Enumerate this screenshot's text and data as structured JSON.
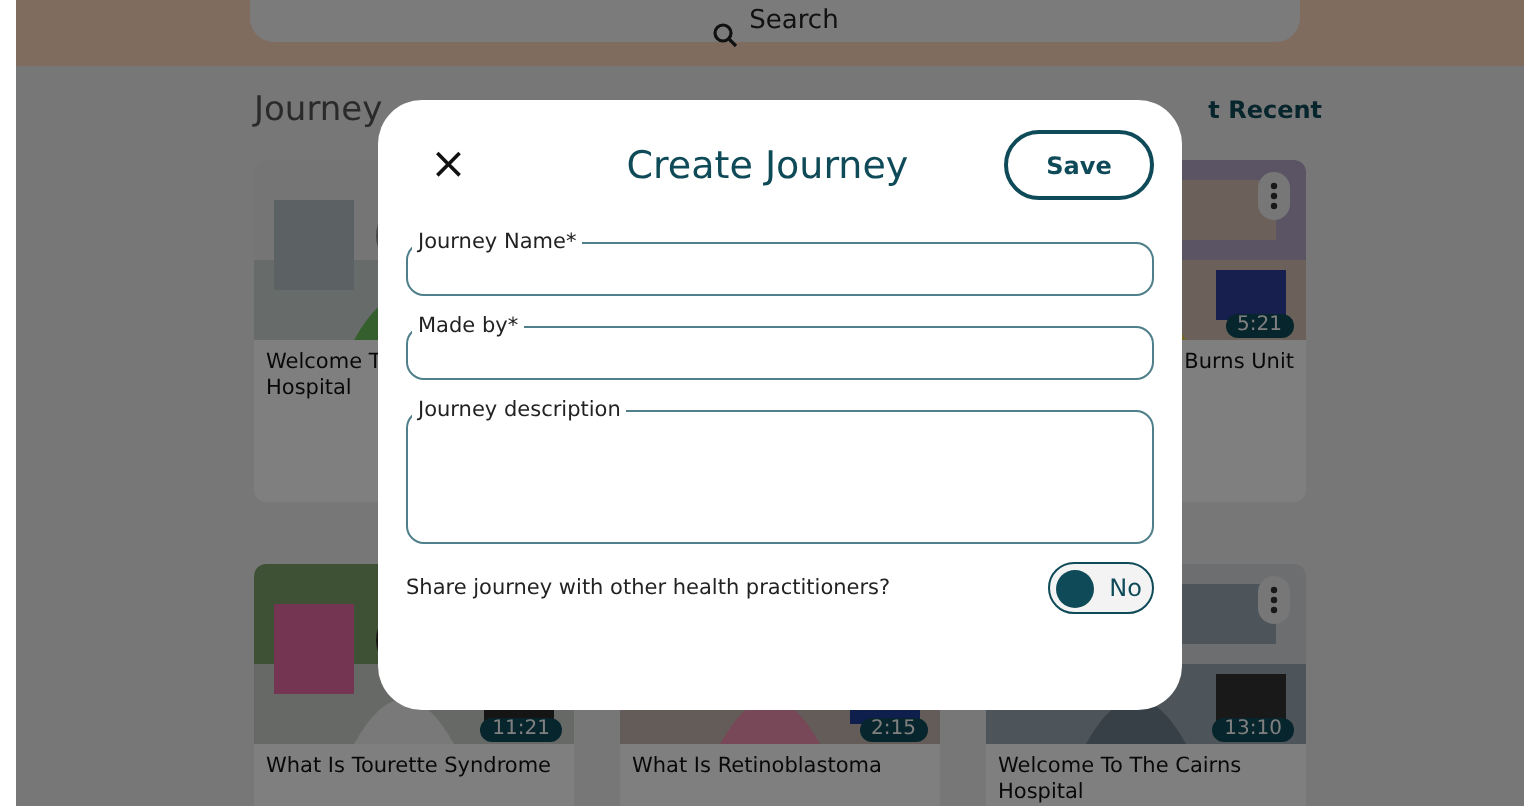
{
  "search": {
    "placeholder": "Search"
  },
  "section": {
    "title": "Journey",
    "sort": "t Recent"
  },
  "rows": [
    {
      "cards": [
        {
          "title_lines": [
            "Welcome T",
            "Hospital"
          ],
          "more": false
        },
        {
          "title_lines": [
            "Burns Unit"
          ],
          "duration": "5:21",
          "more": true
        }
      ]
    },
    {
      "cards": [
        {
          "title_lines": [
            "What Is Tourette Syndrome"
          ],
          "duration": "11:21",
          "more": false
        },
        {
          "title_lines": [
            "What Is Retinoblastoma"
          ],
          "duration": "2:15",
          "more": false
        },
        {
          "title_lines": [
            "Welcome To The Cairns",
            "Hospital"
          ],
          "duration": "13:10",
          "more": true
        }
      ]
    }
  ],
  "dialog": {
    "title": "Create Journey",
    "close": "×",
    "save": "Save",
    "fields": [
      {
        "label": "Journey Name*",
        "kind": "line"
      },
      {
        "label": "Made by*",
        "kind": "line"
      },
      {
        "label": "Journey description",
        "kind": "area"
      }
    ],
    "share": {
      "question": "Share journey with other health practitioners?",
      "on": false,
      "state_label": "No"
    }
  }
}
